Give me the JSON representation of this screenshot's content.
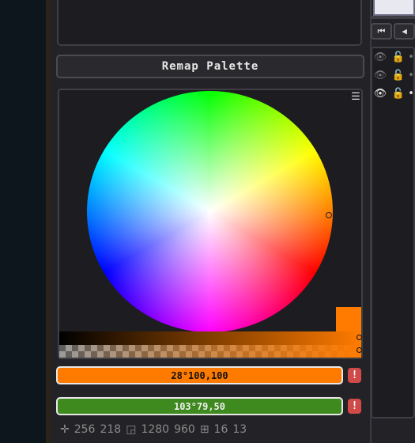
{
  "palette_panel": {
    "remap_label": "Remap Palette",
    "menu_icon": "hamburger-menu-icon"
  },
  "color": {
    "primary": "#ff7b00",
    "secondary": "#3e8a1e",
    "field_a_value": "28°100,100",
    "field_b_value": "103°79,50",
    "warn_label": "!"
  },
  "status_bar": {
    "cursor_x": "256",
    "cursor_y": "218",
    "canvas_w": "1280",
    "canvas_h": "960",
    "grid_w": "16",
    "grid_h": "13",
    "icons": [
      "crosshair-icon",
      "canvas-size-icon",
      "grid-icon"
    ]
  },
  "timeline": {
    "nav_first": "⏮",
    "nav_prev": "◀"
  },
  "layers": {
    "icons": [
      "eye-icon",
      "lock-icon",
      "cel-icon"
    ]
  }
}
